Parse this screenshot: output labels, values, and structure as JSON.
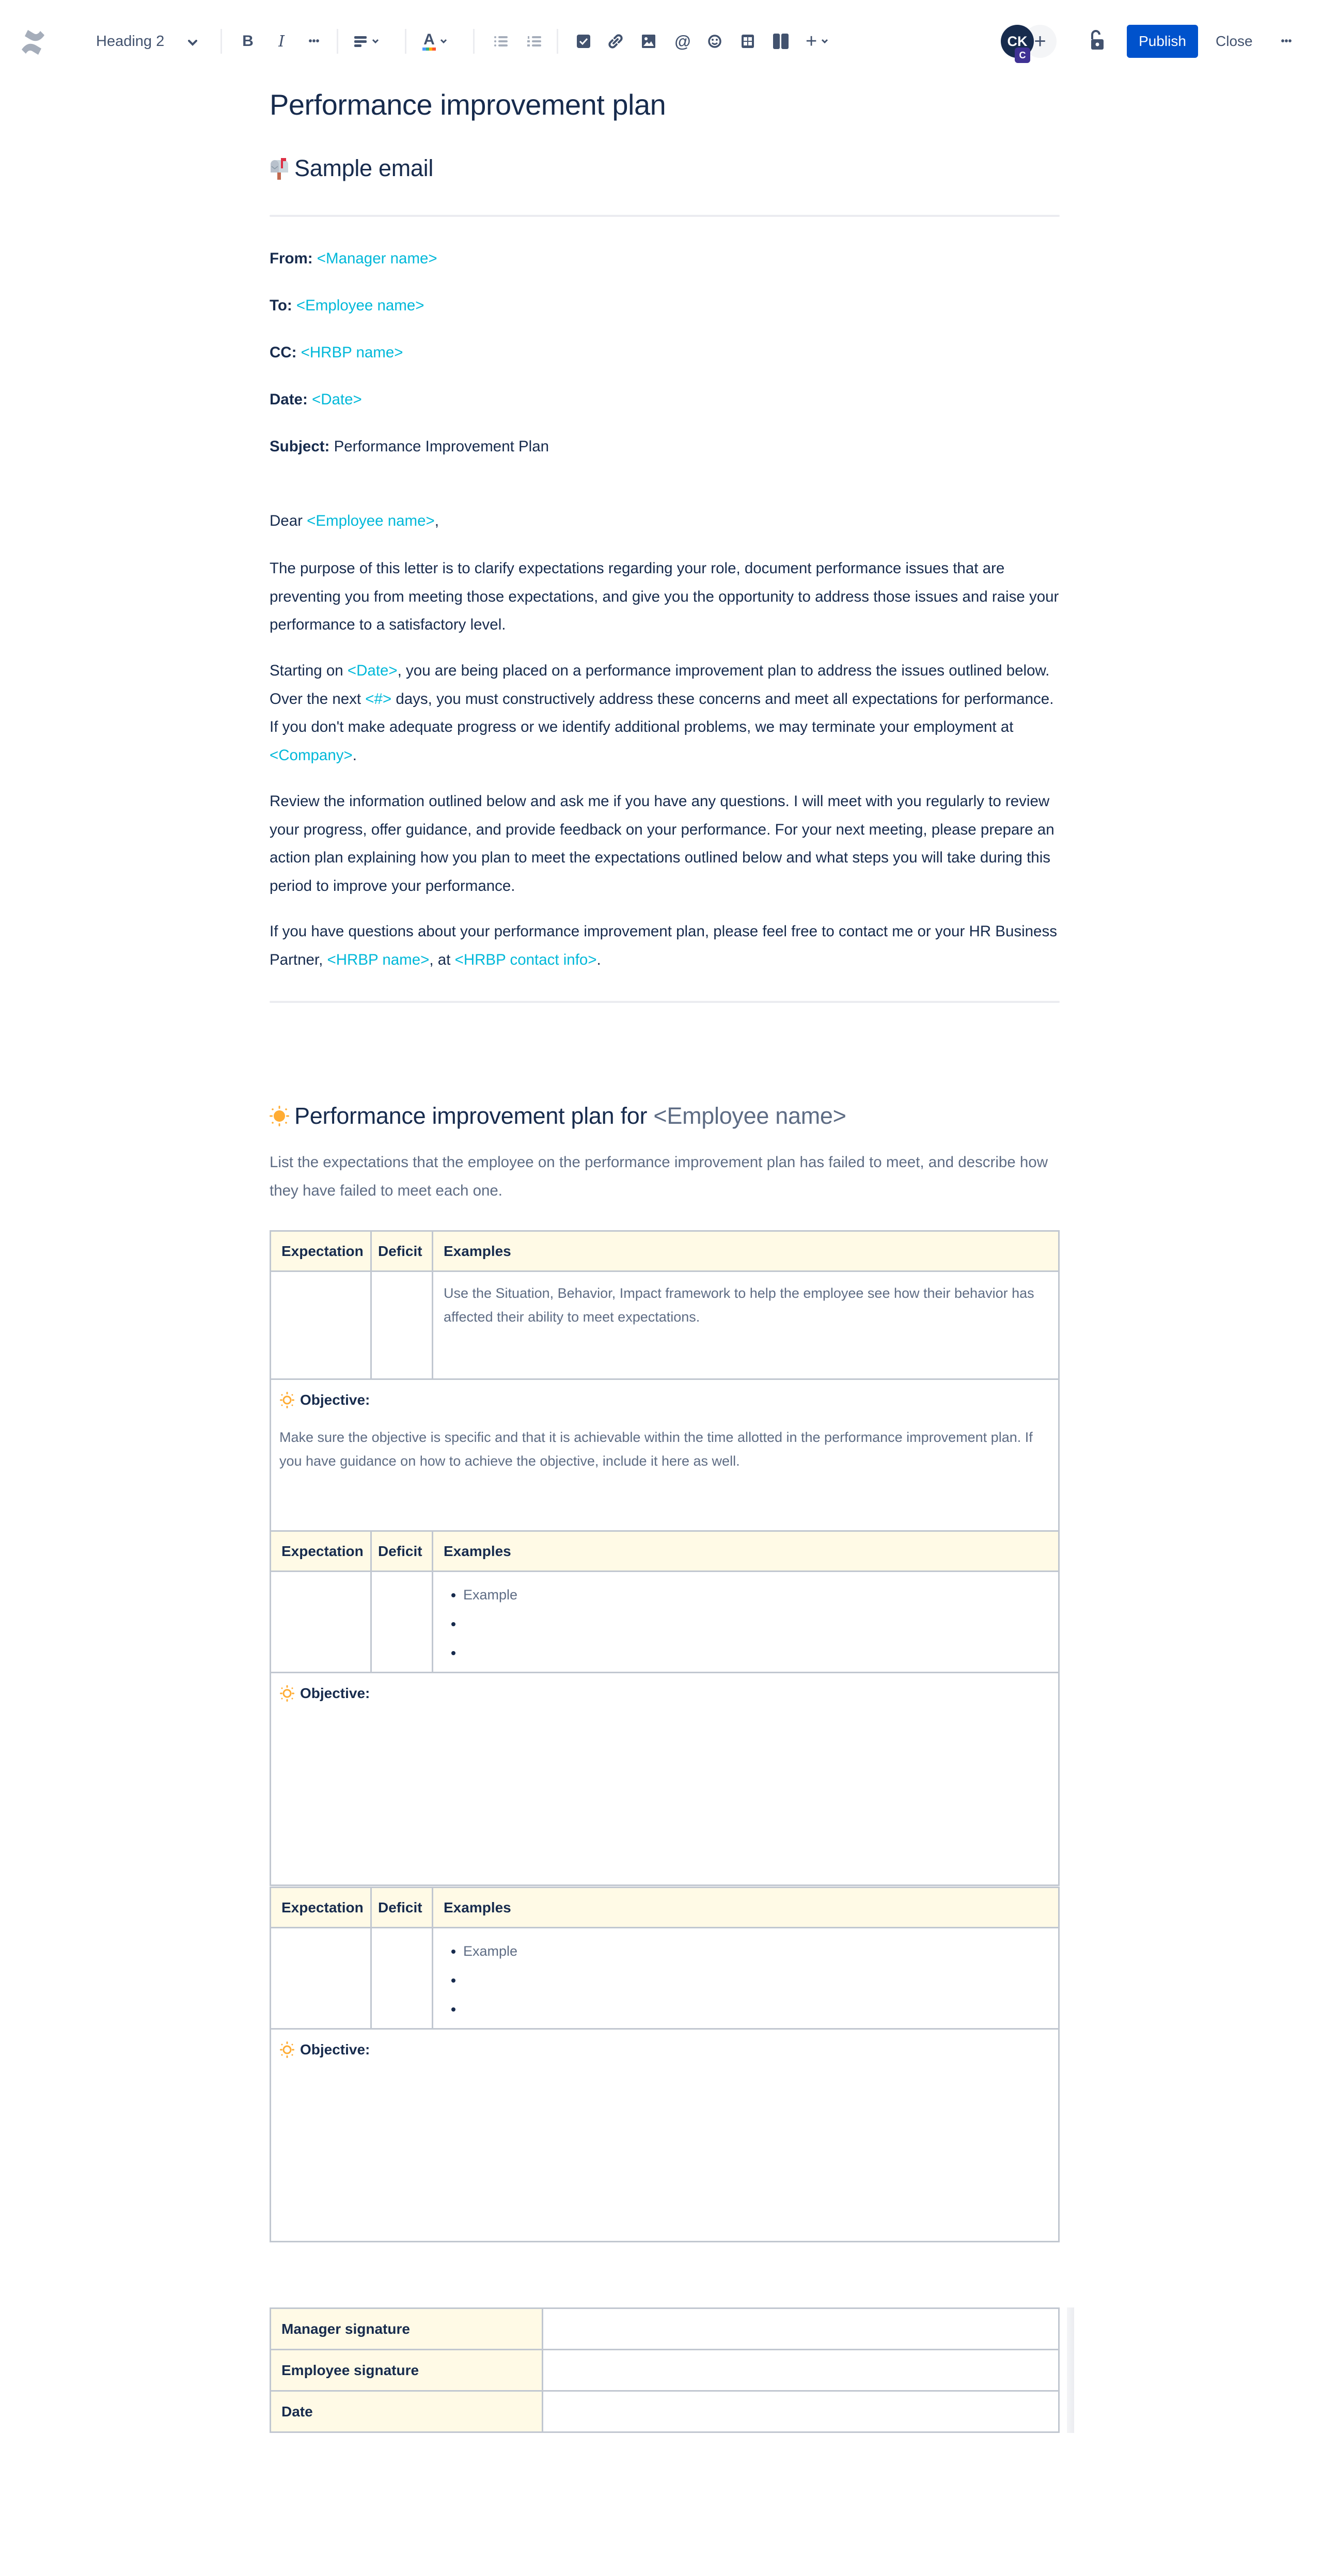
{
  "toolbar": {
    "logo_icon": "confluence-logo-icon",
    "text_style": "Heading 2",
    "buttons": {
      "bold": "B",
      "italic": "I",
      "more_formatting": "•••",
      "alignment": "align-left-icon",
      "text_color": "A",
      "bullet_list": "bullet-list-icon",
      "numbered_list": "numbered-list-icon",
      "action_item": "checkbox-icon",
      "link": "link-icon",
      "image": "image-icon",
      "mention": "@",
      "emoji": "emoji-icon",
      "table": "table-icon",
      "layouts": "layout-icon",
      "insert": "+"
    },
    "avatar_initials": "CK",
    "avatar_badge": "C",
    "invite": "+",
    "restrictions_icon": "unlock-icon",
    "publish_label": "Publish",
    "close_label": "Close",
    "more_label": "•••"
  },
  "colors": {
    "primary": "#0052cc",
    "placeholder_link": "#00b8d9",
    "text": "#172b4d",
    "subtle_text": "#5e6c84",
    "table_header_bg": "#fffae6",
    "border": "#c1c7d0"
  },
  "page": {
    "title": "Performance improvement plan",
    "email_section": {
      "emoji": "mailbox-with-flag",
      "heading": "Sample email",
      "fields": [
        {
          "label": "From:",
          "value": "<Manager name>",
          "placeholder": true
        },
        {
          "label": "To:",
          "value": "<Employee name>",
          "placeholder": true
        },
        {
          "label": "CC:",
          "value": "<HRBP name>",
          "placeholder": true
        },
        {
          "label": "Date:",
          "value": "<Date>",
          "placeholder": true
        },
        {
          "label": "Subject:",
          "value": "Performance Improvement Plan",
          "placeholder": false
        }
      ],
      "greeting": {
        "prefix": "Dear ",
        "name": "<Employee name>",
        "suffix": ","
      },
      "paragraph1": "The purpose of this letter is to clarify expectations regarding your role, document performance issues that are preventing you from meeting those expectations, and give you the opportunity to address those issues and raise your performance to a satisfactory level.",
      "paragraph2": {
        "part1": "Starting on ",
        "date": "<Date>",
        "part2": ", you are being placed on a performance improvement plan to address the issues outlined below. Over the next ",
        "days": "<#>",
        "part3": " days, you must constructively address these concerns and meet all expectations for performance. If you don't make adequate progress or we identify additional problems, we may terminate your employment at ",
        "company": "<Company>",
        "part4": "."
      },
      "paragraph3": "Review the information outlined below and ask me if you have any questions. I will meet with you regularly to review your progress, offer guidance, and provide feedback on your performance. For your next meeting, please prepare an action plan explaining how you plan to meet the expectations outlined below and what steps you will take during this period to improve your performance.",
      "paragraph4": {
        "part1": "If you have questions about your performance improvement plan, please feel free to contact me or your HR Business Partner, ",
        "hrbp_name": "<HRBP name>",
        "part2": ", at ",
        "hrbp_contact": "<HRBP contact info>",
        "part3": "."
      }
    },
    "plan_section": {
      "emoji": "sun",
      "heading_prefix": "Performance improvement plan for ",
      "heading_name": "<Employee name>",
      "description": "List the expectations that the employee on the performance improvement plan has failed to meet, and describe how they have failed to meet each one.",
      "table_headers": [
        "Expectation",
        "Deficit",
        "Examples"
      ],
      "objective_label": "Objective:",
      "blocks": [
        {
          "expectation": "",
          "deficit": "",
          "examples_hint": "Use the Situation, Behavior, Impact framework to help the employee see how their behavior has affected their ability to meet expectations.",
          "examples_list": [],
          "objective_hint": "Make sure the objective is specific and that it is achievable within the time allotted in the performance improvement plan. If you have guidance on how to achieve the objective, include it here as well."
        },
        {
          "expectation": "",
          "deficit": "",
          "examples_hint": "",
          "examples_list": [
            "Example",
            "",
            ""
          ],
          "objective_hint": ""
        },
        {
          "expectation": "",
          "deficit": "",
          "examples_hint": "",
          "examples_list": [
            "Example",
            "",
            ""
          ],
          "objective_hint": ""
        }
      ]
    },
    "signatures": [
      {
        "label": "Manager signature",
        "value": ""
      },
      {
        "label": "Employee signature",
        "value": ""
      },
      {
        "label": "Date",
        "value": ""
      }
    ]
  }
}
